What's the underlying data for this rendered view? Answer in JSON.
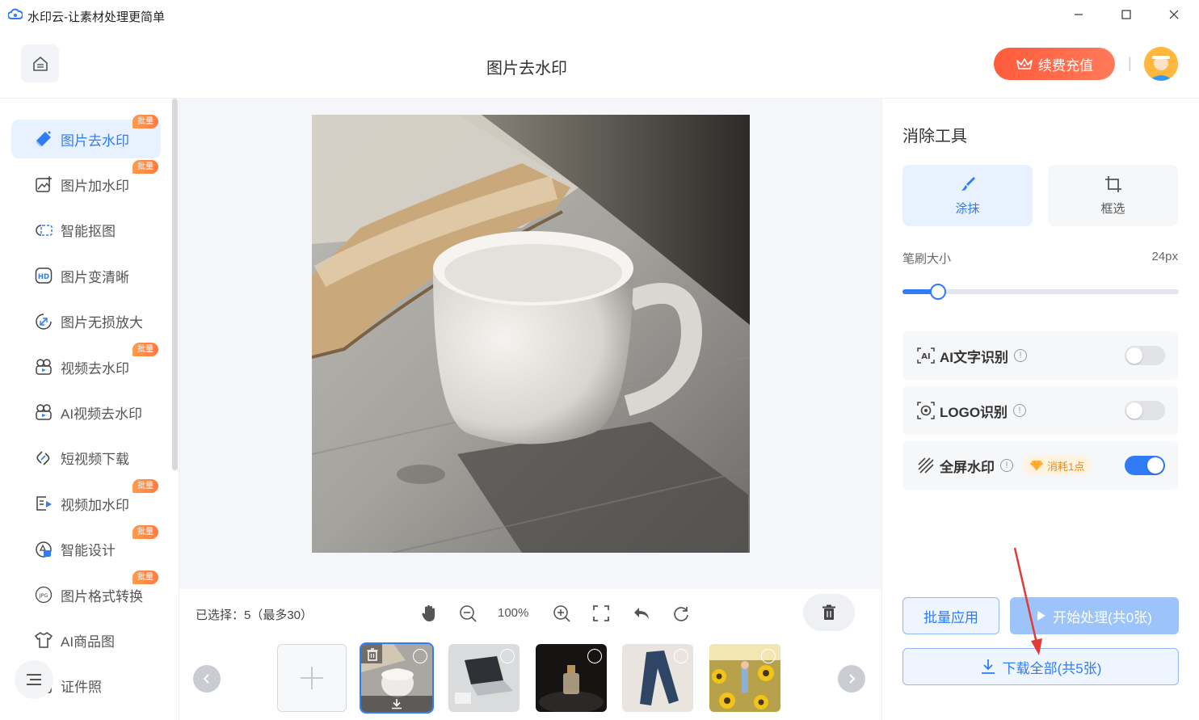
{
  "app": {
    "title": "水印云-让素材处理更简单"
  },
  "header": {
    "page_title": "图片去水印",
    "recharge_label": "续费充值",
    "separator": "|"
  },
  "sidebar": {
    "badge_text": "批量",
    "items": [
      {
        "label": "图片去水印",
        "icon": "eraser-icon",
        "active": true,
        "batch": true
      },
      {
        "label": "图片加水印",
        "icon": "image-add-icon",
        "batch": true
      },
      {
        "label": "智能抠图",
        "icon": "cutout-icon"
      },
      {
        "label": "图片变清晰",
        "icon": "hd-icon"
      },
      {
        "label": "图片无损放大",
        "icon": "enlarge-icon"
      },
      {
        "label": "视频去水印",
        "icon": "video-erase-icon",
        "batch": true
      },
      {
        "label": "AI视频去水印",
        "icon": "ai-video-icon"
      },
      {
        "label": "短视频下载",
        "icon": "link-download-icon"
      },
      {
        "label": "视频加水印",
        "icon": "video-add-icon",
        "batch": true
      },
      {
        "label": "智能设计",
        "icon": "design-icon",
        "batch": true
      },
      {
        "label": "图片格式转换",
        "icon": "jpg-icon",
        "batch": true
      },
      {
        "label": "AI商品图",
        "icon": "shirt-icon"
      },
      {
        "label": "证件照",
        "icon": "id-photo-icon"
      }
    ]
  },
  "toolbar": {
    "selection_info": "已选择：5（最多30）",
    "zoom": "100%"
  },
  "right_panel": {
    "title": "消除工具",
    "modes": [
      {
        "label": "涂抹",
        "active": true
      },
      {
        "label": "框选",
        "active": false
      }
    ],
    "brush_label": "笔刷大小",
    "brush_value": "24px",
    "brush_level": 0.13,
    "options": [
      {
        "label": "AI文字识别",
        "on": false
      },
      {
        "label": "LOGO识别",
        "on": false
      },
      {
        "label": "全屏水印",
        "on": true,
        "badge": "消耗1点"
      }
    ],
    "batch_apply": "批量应用",
    "start_process": "开始处理(共0张)",
    "download_all": "下载全部(共5张)"
  },
  "colors": {
    "accent": "#2f7cf6",
    "recharge": "#ff5b3b",
    "badge": "#ff8a45"
  }
}
